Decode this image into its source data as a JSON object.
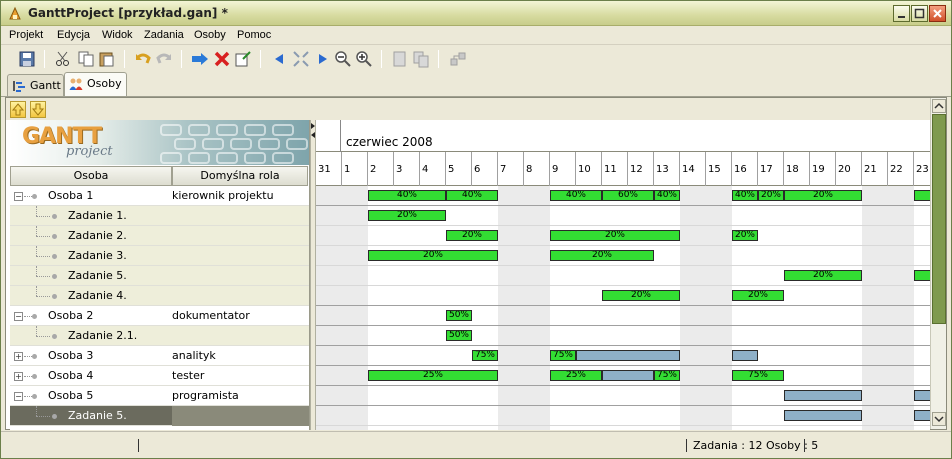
{
  "window": {
    "title": "GanttProject [przykład.gan] *"
  },
  "menu": [
    "Projekt",
    "Edycja",
    "Widok",
    "Zadania",
    "Osoby",
    "Pomoc"
  ],
  "tabs": [
    {
      "label": "Gantt",
      "active": false
    },
    {
      "label": "Osoby",
      "active": true
    }
  ],
  "logo": {
    "text": "GANTT",
    "sub": "project"
  },
  "columns": {
    "person": "Osoba",
    "role": "Domyślna rola"
  },
  "resources": [
    {
      "name": "Osoba 1",
      "role": "kierownik projektu",
      "type": "person",
      "expanded": true
    },
    {
      "name": "Zadanie 1.",
      "role": "",
      "type": "task"
    },
    {
      "name": "Zadanie 2.",
      "role": "",
      "type": "task"
    },
    {
      "name": "Zadanie 3.",
      "role": "",
      "type": "task"
    },
    {
      "name": "Zadanie 5.",
      "role": "",
      "type": "task"
    },
    {
      "name": "Zadanie 4.",
      "role": "",
      "type": "task"
    },
    {
      "name": "Osoba 2",
      "role": "dokumentator",
      "type": "person",
      "expanded": true
    },
    {
      "name": "Zadanie 2.1.",
      "role": "",
      "type": "task"
    },
    {
      "name": "Osoba 3",
      "role": "analityk",
      "type": "person",
      "expanded": false
    },
    {
      "name": "Osoba 4",
      "role": "tester",
      "type": "person",
      "expanded": false
    },
    {
      "name": "Osoba 5",
      "role": "programista",
      "type": "person",
      "expanded": true
    },
    {
      "name": "Zadanie 5.",
      "role": "",
      "type": "task",
      "selected": true
    }
  ],
  "timeline": {
    "month": "czerwiec 2008",
    "days": [
      "31",
      "1",
      "2",
      "3",
      "4",
      "5",
      "6",
      "7",
      "8",
      "9",
      "10",
      "11",
      "12",
      "13",
      "14",
      "15",
      "16",
      "17",
      "18",
      "19",
      "20",
      "21",
      "22",
      "23"
    ],
    "weekend_days": [
      "31",
      "1",
      "7",
      "8",
      "14",
      "15",
      "21",
      "22"
    ]
  },
  "bars": [
    {
      "row": 0,
      "start": "2",
      "end": "5",
      "label": "40%",
      "color": "green"
    },
    {
      "row": 0,
      "start": "5",
      "end": "7",
      "label": "40%",
      "color": "green"
    },
    {
      "row": 0,
      "start": "9",
      "end": "11",
      "label": "40%",
      "color": "green"
    },
    {
      "row": 0,
      "start": "11",
      "end": "13",
      "label": "60%",
      "color": "green"
    },
    {
      "row": 0,
      "start": "13",
      "end": "14",
      "label": "40%",
      "color": "green"
    },
    {
      "row": 0,
      "start": "16",
      "end": "17",
      "label": "40%",
      "color": "green"
    },
    {
      "row": 0,
      "start": "17",
      "end": "18",
      "label": "20%",
      "color": "green"
    },
    {
      "row": 0,
      "start": "18",
      "end": "21",
      "label": "20%",
      "color": "green"
    },
    {
      "row": 0,
      "start": "23",
      "end": "24",
      "label": "",
      "color": "green"
    },
    {
      "row": 1,
      "start": "2",
      "end": "5",
      "label": "20%",
      "color": "green"
    },
    {
      "row": 2,
      "start": "5",
      "end": "7",
      "label": "20%",
      "color": "green"
    },
    {
      "row": 2,
      "start": "9",
      "end": "14",
      "label": "20%",
      "color": "green"
    },
    {
      "row": 2,
      "start": "16",
      "end": "17",
      "label": "20%",
      "color": "green"
    },
    {
      "row": 3,
      "start": "2",
      "end": "7",
      "label": "20%",
      "color": "green"
    },
    {
      "row": 3,
      "start": "9",
      "end": "13",
      "label": "20%",
      "color": "green"
    },
    {
      "row": 4,
      "start": "18",
      "end": "21",
      "label": "20%",
      "color": "green"
    },
    {
      "row": 4,
      "start": "23",
      "end": "24",
      "label": "",
      "color": "green"
    },
    {
      "row": 5,
      "start": "11",
      "end": "14",
      "label": "20%",
      "color": "green"
    },
    {
      "row": 5,
      "start": "16",
      "end": "18",
      "label": "20%",
      "color": "green"
    },
    {
      "row": 6,
      "start": "5",
      "end": "6",
      "label": "50%",
      "color": "green"
    },
    {
      "row": 7,
      "start": "5",
      "end": "6",
      "label": "50%",
      "color": "green"
    },
    {
      "row": 8,
      "start": "6",
      "end": "7",
      "label": "75%",
      "color": "green"
    },
    {
      "row": 8,
      "start": "9",
      "end": "10",
      "label": "75%",
      "color": "green"
    },
    {
      "row": 8,
      "start": "10",
      "end": "14",
      "label": "",
      "color": "blue"
    },
    {
      "row": 8,
      "start": "16",
      "end": "17",
      "label": "",
      "color": "blue"
    },
    {
      "row": 9,
      "start": "2",
      "end": "7",
      "label": "25%",
      "color": "green"
    },
    {
      "row": 9,
      "start": "9",
      "end": "11",
      "label": "25%",
      "color": "green"
    },
    {
      "row": 9,
      "start": "11",
      "end": "13",
      "label": "",
      "color": "blue"
    },
    {
      "row": 9,
      "start": "13",
      "end": "14",
      "label": "75%",
      "color": "green"
    },
    {
      "row": 9,
      "start": "16",
      "end": "18",
      "label": "75%",
      "color": "green"
    },
    {
      "row": 10,
      "start": "18",
      "end": "21",
      "label": "",
      "color": "blue"
    },
    {
      "row": 10,
      "start": "23",
      "end": "24",
      "label": "",
      "color": "blue"
    },
    {
      "row": 11,
      "start": "18",
      "end": "21",
      "label": "",
      "color": "blue"
    },
    {
      "row": 11,
      "start": "23",
      "end": "24",
      "label": "",
      "color": "blue"
    }
  ],
  "status": {
    "left": "",
    "right": "Zadania : 12  Osoby : 5"
  },
  "colors": {
    "bar_green": "#33dd33",
    "bar_blue": "#8eb0c8",
    "titlebar": "#d7dba0",
    "scroll_thumb": "#7f9a4e",
    "selected_row": "#6b6b5e"
  }
}
